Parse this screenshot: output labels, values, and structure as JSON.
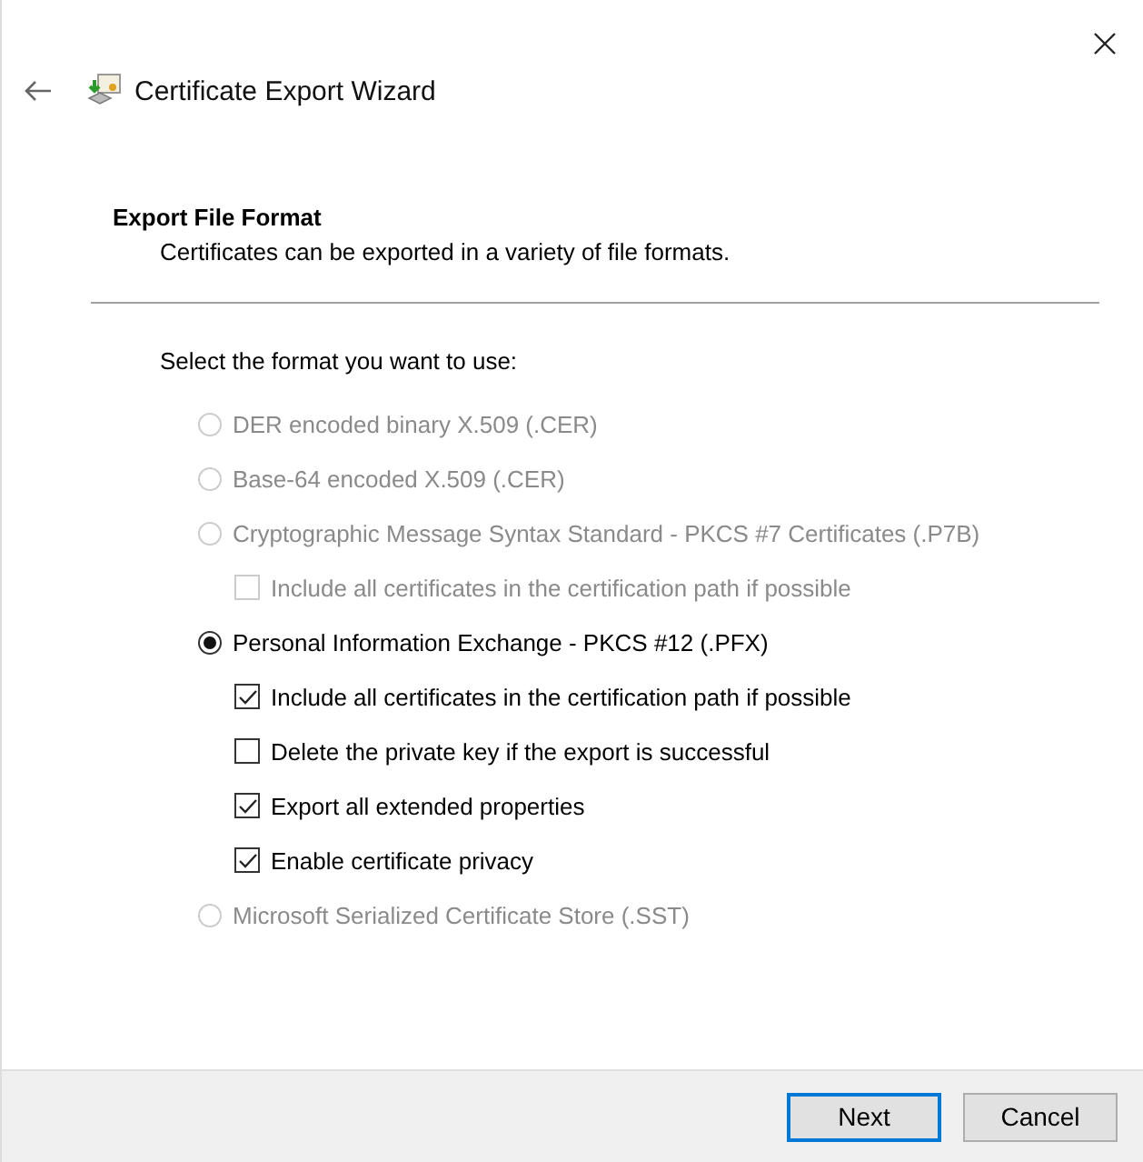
{
  "window": {
    "title": "Certificate Export Wizard"
  },
  "header": {
    "title": "Export File Format",
    "subtitle": "Certificates can be exported in a variety of file formats."
  },
  "prompt": "Select the format you want to use:",
  "options": [
    {
      "label": "DER encoded binary X.509 (.CER)",
      "selected": false,
      "disabled": true
    },
    {
      "label": "Base-64 encoded X.509 (.CER)",
      "selected": false,
      "disabled": true
    },
    {
      "label": "Cryptographic Message Syntax Standard - PKCS #7 Certificates (.P7B)",
      "selected": false,
      "disabled": true,
      "children": [
        {
          "label": "Include all certificates in the certification path if possible",
          "checked": false,
          "disabled": true
        }
      ]
    },
    {
      "label": "Personal Information Exchange - PKCS #12 (.PFX)",
      "selected": true,
      "disabled": false,
      "children": [
        {
          "label": "Include all certificates in the certification path if possible",
          "checked": true,
          "disabled": false
        },
        {
          "label": "Delete the private key if the export is successful",
          "checked": false,
          "disabled": false
        },
        {
          "label": "Export all extended properties",
          "checked": true,
          "disabled": false
        },
        {
          "label": "Enable certificate privacy",
          "checked": true,
          "disabled": false
        }
      ]
    },
    {
      "label": "Microsoft Serialized Certificate Store (.SST)",
      "selected": false,
      "disabled": true
    }
  ],
  "buttons": [
    {
      "label": "Next",
      "selected": true
    },
    {
      "label": "Cancel",
      "selected": false
    }
  ]
}
